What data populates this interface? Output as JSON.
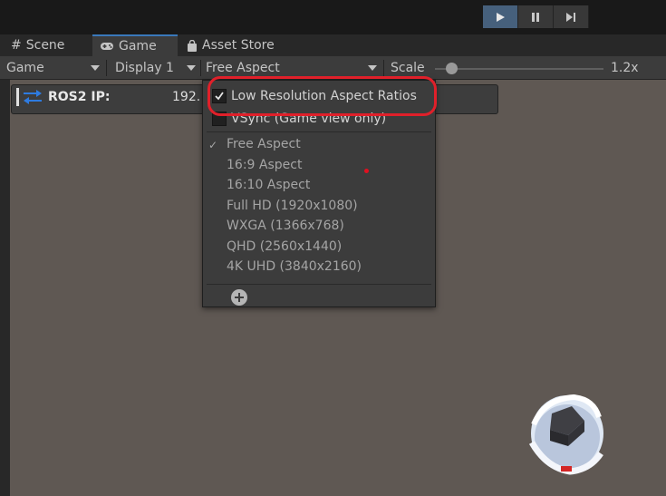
{
  "playback": {
    "play": "play-icon",
    "pause": "pause-icon",
    "step": "step-icon"
  },
  "tabs": [
    {
      "label": "Scene",
      "icon": "hash-icon"
    },
    {
      "label": "Game",
      "icon": "gamepad-icon"
    },
    {
      "label": "Asset Store",
      "icon": "bag-icon"
    }
  ],
  "controls": {
    "view_mode": "Game",
    "display": "Display 1",
    "aspect": "Free Aspect",
    "scale_label": "Scale",
    "scale_value": "1.2x",
    "scale_fraction": 0.1
  },
  "ros": {
    "label": "ROS2 IP:",
    "ip": "192."
  },
  "dropdown": {
    "low_res_label": "Low Resolution Aspect Ratios",
    "low_res_checked": true,
    "vsync_label": "VSync (Game view only)",
    "vsync_checked": false,
    "selected_mark": "✓",
    "aspects": [
      "Free Aspect",
      "16:9 Aspect",
      "16:10 Aspect",
      "Full HD (1920x1080)",
      "WXGA (1366x768)",
      "QHD (2560x1440)",
      "4K UHD (3840x2160)"
    ],
    "add_icon": "plus-circle-icon"
  },
  "colors": {
    "highlight": "#e0202a",
    "active_play": "#46607c",
    "game_bg": "#5f5853"
  }
}
